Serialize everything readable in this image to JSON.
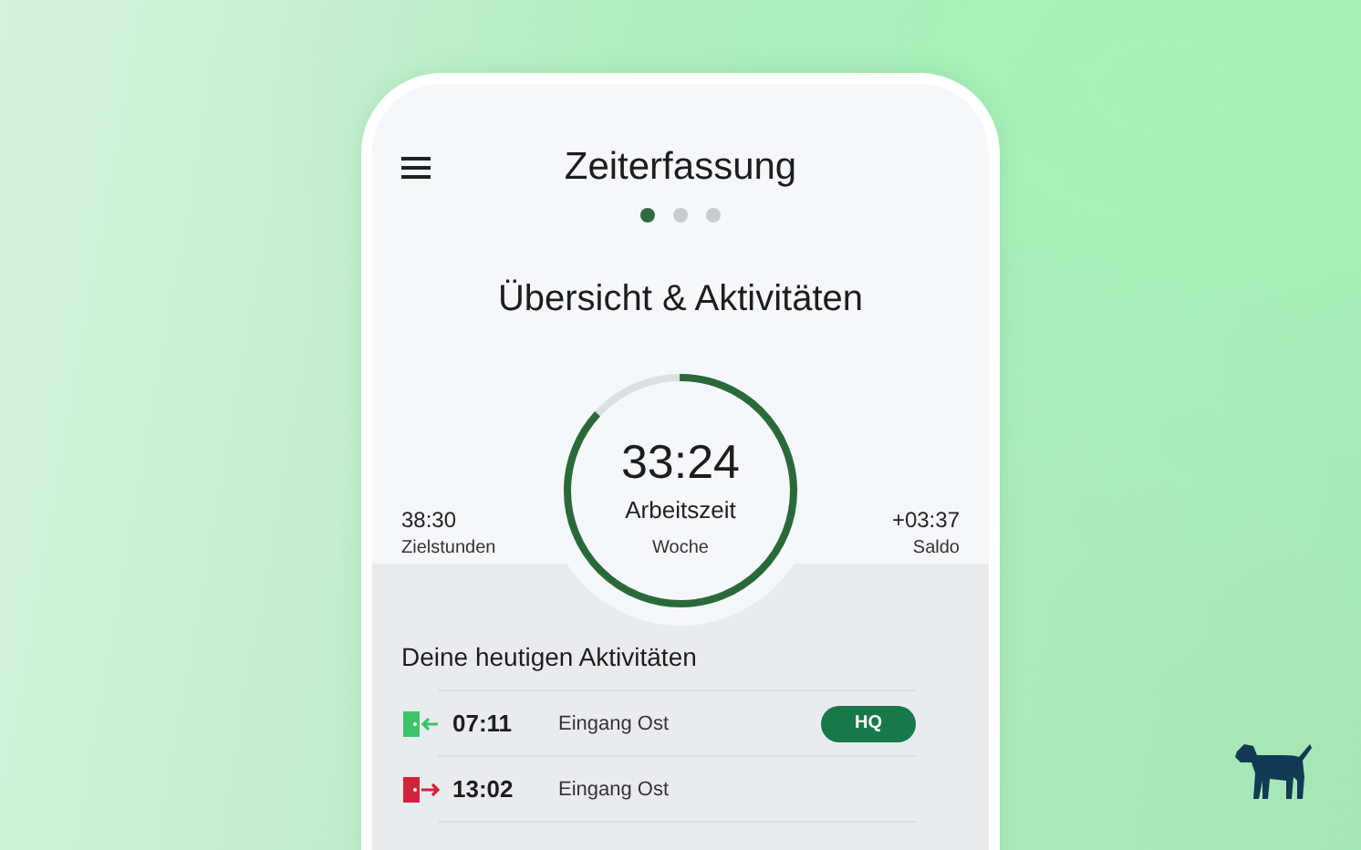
{
  "app_bar": {
    "title": "Zeiterfassung"
  },
  "pager": [
    {
      "selected": true
    },
    {
      "selected": false
    },
    {
      "selected": false
    }
  ],
  "heading": "Übersicht & Aktivitäten",
  "summary": {
    "target": {
      "value": "38:30",
      "label": "Zielstunden"
    },
    "ring": {
      "value": "33:24",
      "label": "Arbeitszeit",
      "period": "Woche"
    },
    "balance": {
      "value": "+03:37",
      "label": "Saldo"
    }
  },
  "activities": {
    "title": "Deine heutigen Aktivitäten",
    "rows": [
      {
        "kind": "in",
        "time": "07:11",
        "place": "Eingang Ost",
        "badge": "HQ"
      },
      {
        "kind": "out",
        "time": "13:02",
        "place": "Eingang Ost"
      }
    ]
  }
}
